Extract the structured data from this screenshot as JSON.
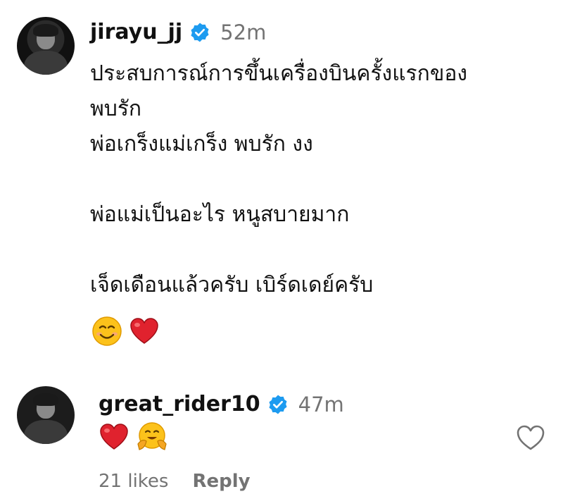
{
  "comments": [
    {
      "username": "jirayu_jj",
      "verified": true,
      "time": "52m",
      "lines": [
        "ประสบการณ์การขึ้นเครื่องบินครั้งแรกของ",
        "พบรัก",
        "พ่อเกร็งแม่เกร็ง พบรัก งง",
        "",
        "พ่อแม่เป็นอะไร หนูสบายมาก",
        "",
        "เจ็ดเดือนแล้วครับ เบิร์ดเดย์ครับ",
        ""
      ],
      "emojis": [
        "smiling-face-icon",
        "red-heart-icon"
      ]
    },
    {
      "username": "great_rider10",
      "verified": true,
      "time": "47m",
      "emojis": [
        "red-heart-icon",
        "hugging-face-icon"
      ],
      "likes": "21 likes",
      "reply_label": "Reply"
    }
  ],
  "colors": {
    "verified_blue": "#1d9bf0",
    "meta_gray": "#737373",
    "heart_red": "#e0222e"
  }
}
